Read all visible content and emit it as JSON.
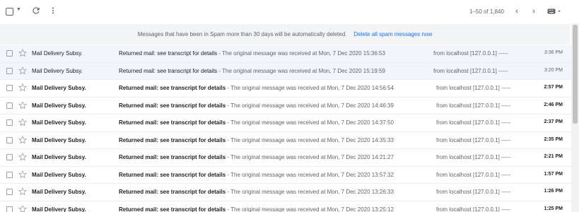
{
  "toolbar": {
    "range_label": "1–50 of 1,840",
    "icons": [
      "select-checkbox",
      "caret-down-icon",
      "refresh-icon",
      "more-vert-icon",
      "chevron-left-icon",
      "chevron-right-icon",
      "keyboard-icon"
    ]
  },
  "banner": {
    "message": "Messages that have been in Spam more than 30 days will be automatically deleted.",
    "action": "Delete all spam messages now"
  },
  "emails": [
    {
      "sender": "Mail Delivery Subsy.",
      "subject": "Returned mail: see transcript for details",
      "snippet": " - The original message was received at Mon, 7 Dec 2020 15:36:53",
      "extra": "from localhost [127.0.0.1] -----",
      "time": "3:36 PM",
      "unread": false
    },
    {
      "sender": "Mail Delivery Subsy.",
      "subject": "Returned mail: see transcript for details",
      "snippet": " - The original message was received at Mon, 7 Dec 2020 15:19:59",
      "extra": "from localhost [127.0.0.1] -----",
      "time": "3:20 PM",
      "unread": false
    },
    {
      "sender": "Mail Delivery Subsy.",
      "subject": "Returned mail: see transcript for details",
      "snippet": " - The original message was received at Mon, 7 Dec 2020 14:56:54",
      "extra": "from localhost [127.0.0.1] -----",
      "time": "2:57 PM",
      "unread": true
    },
    {
      "sender": "Mail Delivery Subsy.",
      "subject": "Returned mail: see transcript for details",
      "snippet": " - The original message was received at Mon, 7 Dec 2020 14:46:39",
      "extra": "from localhost [127.0.0.1] -----",
      "time": "2:46 PM",
      "unread": true
    },
    {
      "sender": "Mail Delivery Subsy.",
      "subject": "Returned mail: see transcript for details",
      "snippet": " - The original message was received at Mon, 7 Dec 2020 14:37:50",
      "extra": "from localhost [127.0.0.1] -----",
      "time": "2:37 PM",
      "unread": true
    },
    {
      "sender": "Mail Delivery Subsy.",
      "subject": "Returned mail: see transcript for details",
      "snippet": " - The original message was received at Mon, 7 Dec 2020 14:35:33",
      "extra": "from localhost [127.0.0.1] -----",
      "time": "2:35 PM",
      "unread": true
    },
    {
      "sender": "Mail Delivery Subsy.",
      "subject": "Returned mail: see transcript for details",
      "snippet": " - The original message was received at Mon, 7 Dec 2020 14:21:27",
      "extra": "from localhost [127.0.0.1] -----",
      "time": "2:21 PM",
      "unread": true
    },
    {
      "sender": "Mail Delivery Subsy.",
      "subject": "Returned mail: see transcript for details",
      "snippet": " - The original message was received at Mon, 7 Dec 2020 13:57:32",
      "extra": "from localhost [127.0.0.1] -----",
      "time": "1:57 PM",
      "unread": true
    },
    {
      "sender": "Mail Delivery Subsy.",
      "subject": "Returned mail: see transcript for details",
      "snippet": " - The original message was received at Mon, 7 Dec 2020 13:26:33",
      "extra": "from localhost [127.0.0.1] -----",
      "time": "1:26 PM",
      "unread": true
    },
    {
      "sender": "Mail Delivery Subsy.",
      "subject": "Returned mail: see transcript for details",
      "snippet": " - The original message was received at Mon, 7 Dec 2020 13:25:12",
      "extra": "from localhost [127.0.0.1] -----",
      "time": "1:25 PM",
      "unread": true
    }
  ]
}
